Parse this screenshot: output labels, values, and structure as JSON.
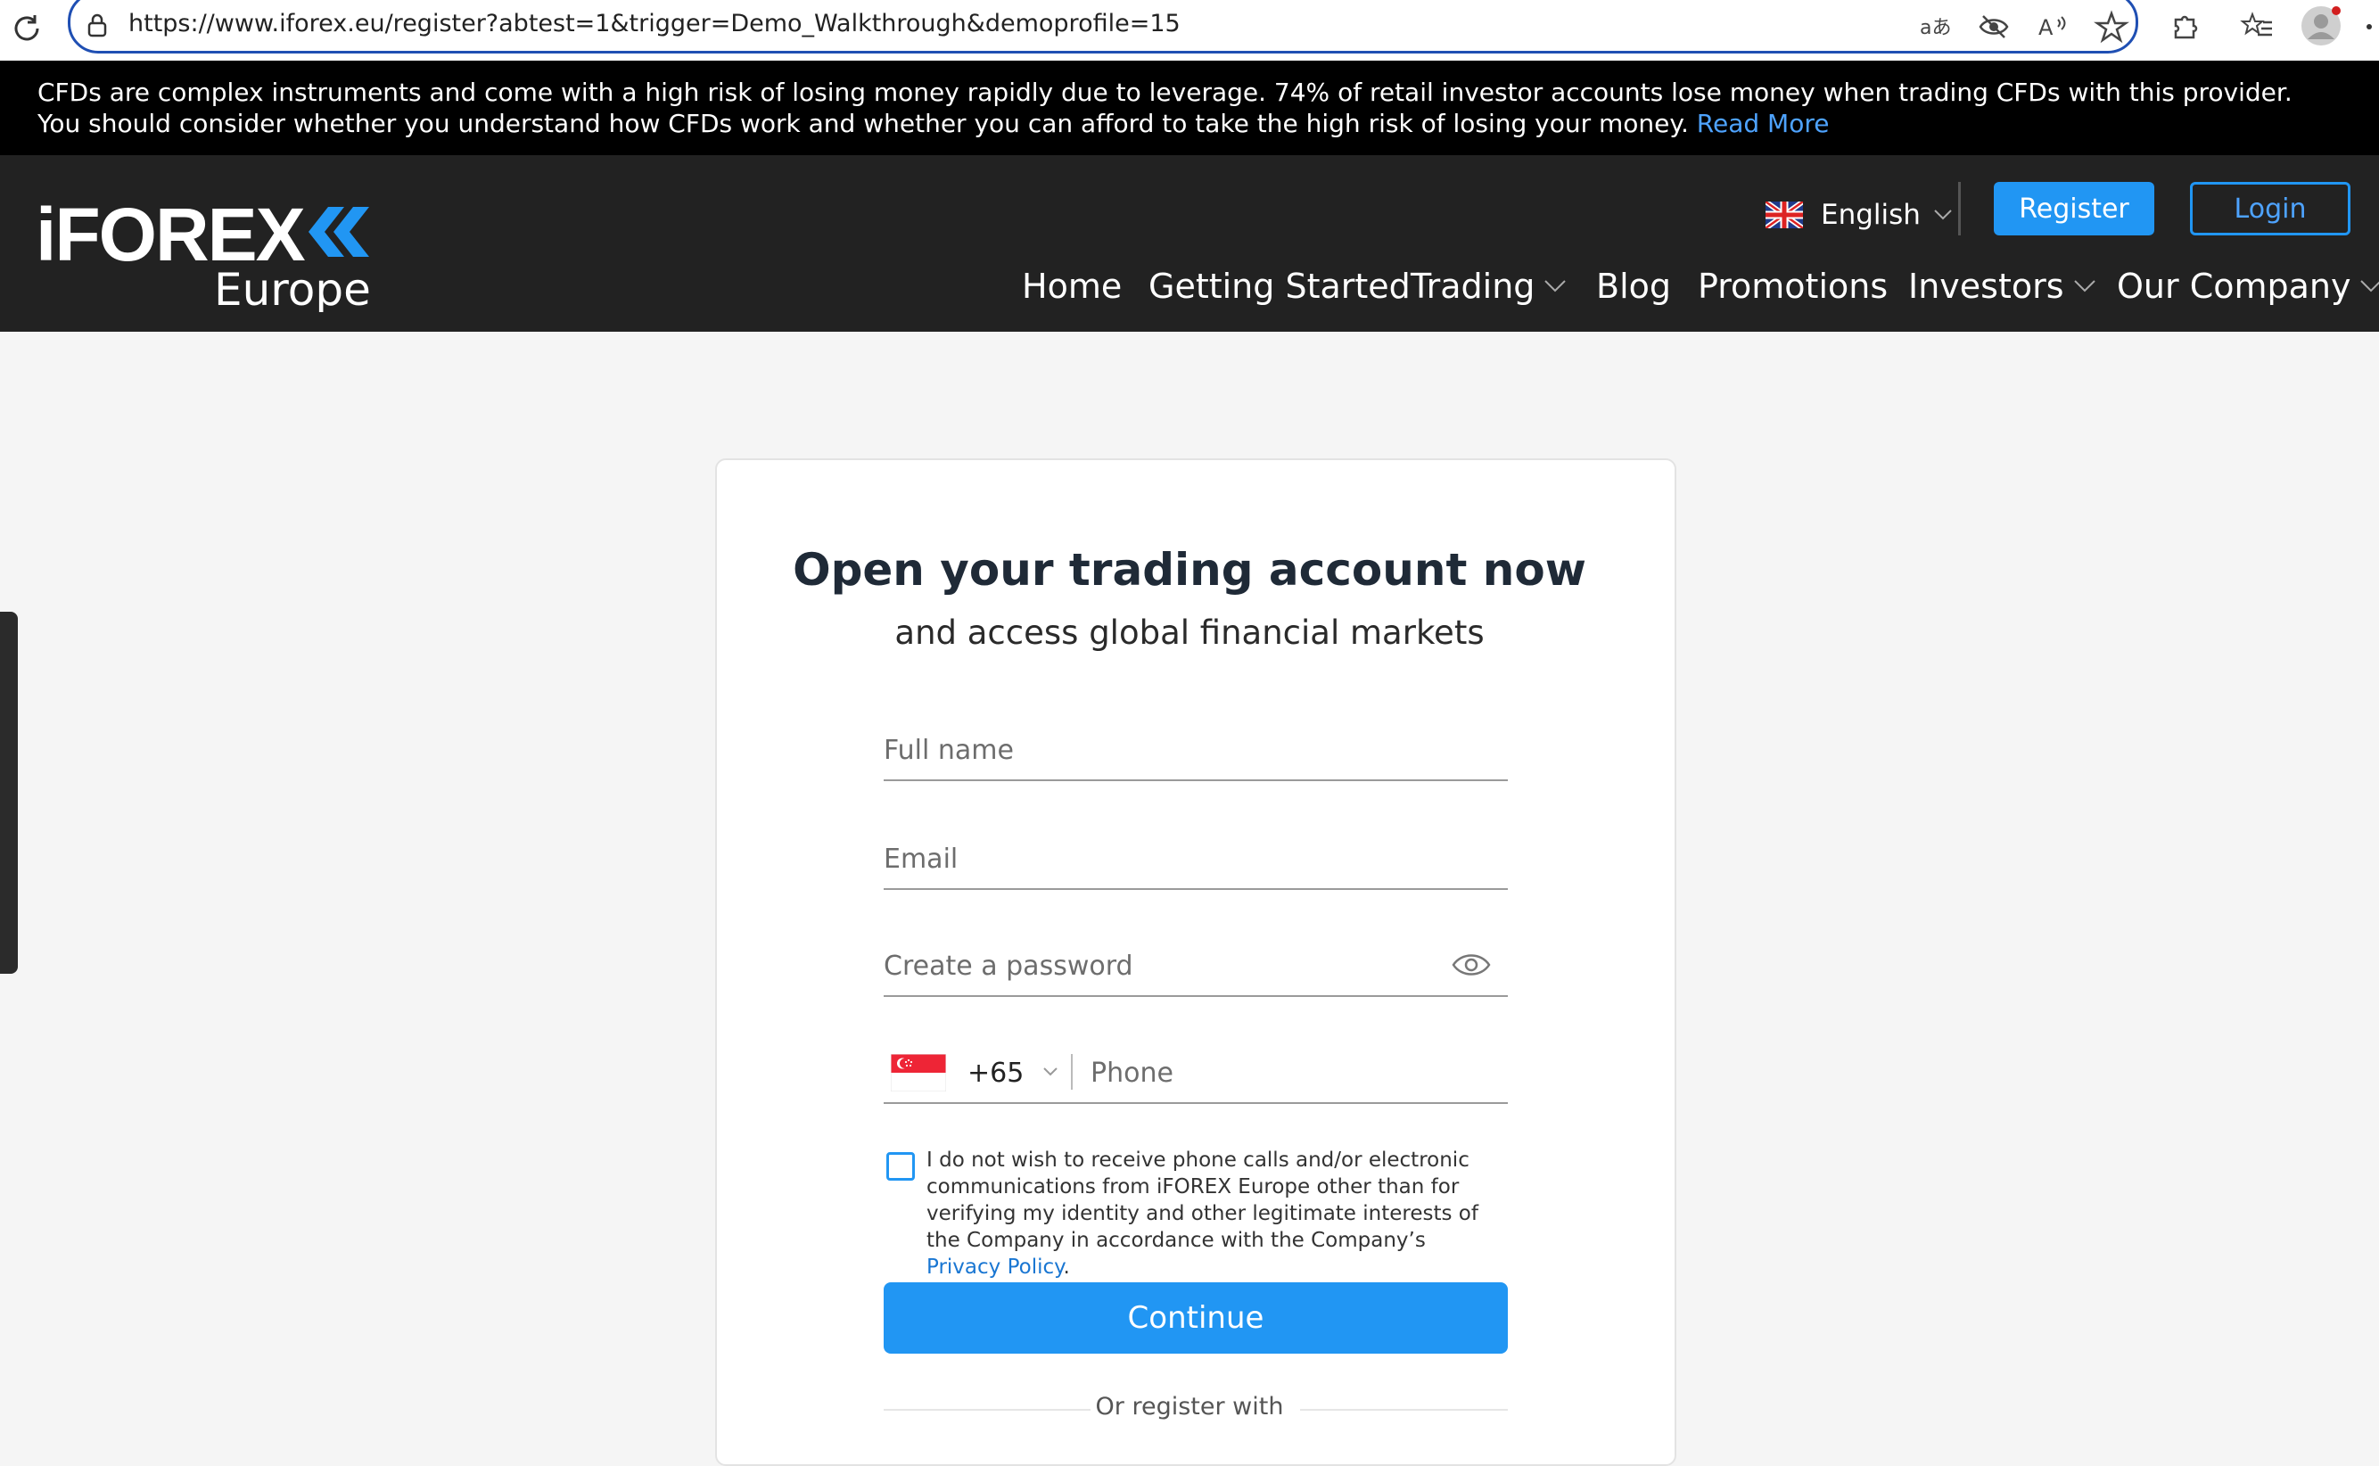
{
  "browser": {
    "url": "https://www.iforex.eu/register?abtest=1&trigger=Demo_Walkthrough&demoprofile=15"
  },
  "warning": {
    "line1": "CFDs are complex instruments and come with a high risk of losing money rapidly due to leverage. 74% of retail investor accounts lose money when trading CFDs with this provider.",
    "line2": "You should consider whether you understand how CFDs work and whether you can afford to take the high risk of losing your money.",
    "read_more": "Read More"
  },
  "header": {
    "logo_main": "iFOREX",
    "logo_sub": "Europe",
    "language": "English",
    "register_label": "Register",
    "login_label": "Login",
    "nav": {
      "home": "Home",
      "getting_started": "Getting Started",
      "trading": "Trading",
      "blog": "Blog",
      "promotions": "Promotions",
      "investors": "Investors",
      "our_company": "Our Company"
    }
  },
  "form": {
    "title": "Open your trading account now",
    "subtitle": "and access global financial markets",
    "full_name_placeholder": "Full name",
    "email_placeholder": "Email",
    "password_placeholder": "Create a password",
    "country_code": "+65",
    "phone_placeholder": "Phone",
    "consent_text": "I do not wish to receive phone calls and/or electronic communications from iFOREX Europe other than for verifying my identity and other legitimate interests of the Company in accordance with the Company’s",
    "privacy_policy": "Privacy Policy",
    "consent_end": ".",
    "continue_label": "Continue",
    "or_register_with": "Or register with"
  },
  "colors": {
    "accent": "#2196f3",
    "header_bg": "#222222",
    "banner_bg": "#000000",
    "page_bg": "#f5f5f5"
  }
}
